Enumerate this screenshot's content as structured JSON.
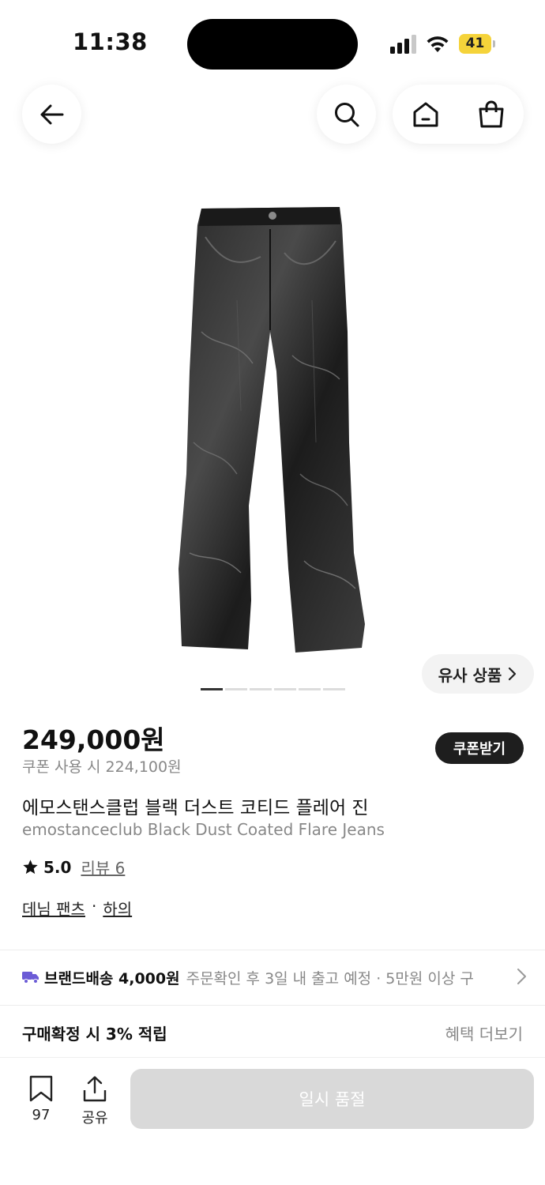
{
  "status_bar": {
    "time": "11:38",
    "battery": "41"
  },
  "nav": {
    "back_icon": "arrow-left-icon",
    "search_icon": "search-icon",
    "home_icon": "home-icon",
    "cart_icon": "shopping-bag-icon"
  },
  "gallery": {
    "similar_label": "유사 상품",
    "image_count": 6,
    "active_index": 0
  },
  "product": {
    "price": "249,000원",
    "coupon_price": "쿠폰 사용 시 224,100원",
    "coupon_button": "쿠폰받기",
    "name_ko": "에모스탠스클럽 블랙 더스트 코티드 플레어 진",
    "name_en": "emostanceclub Black Dust Coated Flare Jeans",
    "rating": "5.0",
    "review_label": "리뷰 6",
    "category_1": "데님 팬츠",
    "category_sep": "·",
    "category_2": "하의"
  },
  "shipping": {
    "label": "브랜드배송 4,000원",
    "detail": "주문확인 후 3일 내 출고 예정 · 5만원 이상 구",
    "icon_color": "#6b5bd6"
  },
  "benefit": {
    "label": "구매확정 시 3% 적립",
    "more": "혜택 더보기"
  },
  "bottom": {
    "wishlist_count": "97",
    "share_label": "공유",
    "soldout_label": "일시 품절"
  },
  "colors": {
    "text_primary": "#111111",
    "text_secondary": "#888888",
    "button_dark": "#1e1e1e",
    "button_disabled": "#d9d9d9"
  }
}
